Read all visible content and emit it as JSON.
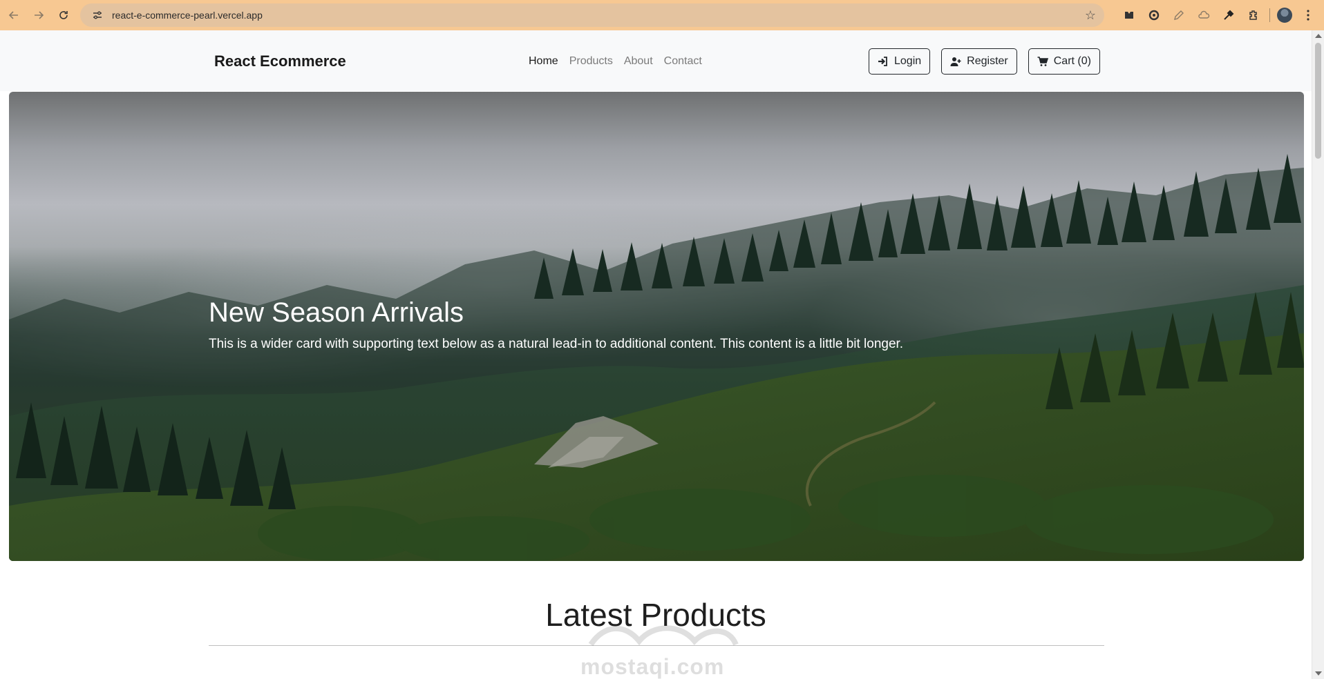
{
  "browser": {
    "url": "react-e-commerce-pearl.vercel.app",
    "icons": [
      "back-icon",
      "forward-icon",
      "reload-icon",
      "site-settings-icon",
      "bookmark-star-icon",
      "extensions-icon",
      "menu-icon"
    ]
  },
  "navbar": {
    "brand": "React Ecommerce",
    "links": [
      {
        "label": "Home",
        "active": true
      },
      {
        "label": "Products",
        "active": false
      },
      {
        "label": "About",
        "active": false
      },
      {
        "label": "Contact",
        "active": false
      }
    ],
    "buttons": {
      "login": "Login",
      "register": "Register",
      "cart": "Cart (0)"
    }
  },
  "hero": {
    "title": "New Season Arrivals",
    "text": "This is a wider card with supporting text below as a natural lead-in to additional content. This content is a little bit longer."
  },
  "latest": {
    "title": "Latest Products"
  },
  "watermark": "mostaqi.com"
}
